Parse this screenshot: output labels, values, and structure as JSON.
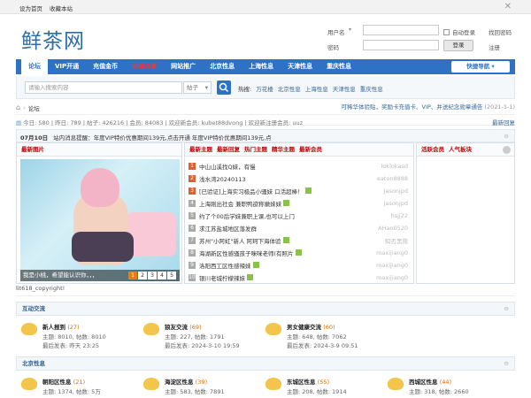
{
  "topbar": {
    "set_home": "设为首页",
    "bookmark": "收藏本站"
  },
  "header": {
    "logo": "鲜茶网",
    "username_label": "用户名",
    "password_label": "密码",
    "auto_login": "自动登录",
    "find_password": "找回密码",
    "login_btn": "登录",
    "register": "注册"
  },
  "nav": {
    "items": [
      "论坛",
      "VIP开通",
      "充值金币",
      "同城必看",
      "网站推广",
      "北京性息",
      "上海性息",
      "天津性息",
      "重庆性息"
    ],
    "quick": "快捷导航"
  },
  "search": {
    "placeholder": "请输入搜索内容",
    "type": "帖子",
    "hot_label": "热搜:",
    "hot": [
      "万花楼",
      "北京性息",
      "上海性息",
      "天津性息",
      "重庆性息"
    ]
  },
  "crumb": {
    "current": "论坛",
    "notice": "可稀华体验贴，奖励卡充值卡、VIP、并送纪念勋章通告",
    "notice_date": "(2021-1-1)"
  },
  "stats": {
    "text": "今日: 580 | 昨日: 789 | 帖子: 426216 | 会员: 84083 | 欢迎新会员: kubet88dvong | 欢迎新注册会员: uuz",
    "latest": "最新回复"
  },
  "announce": {
    "date": "07月10日",
    "text": "站内消息提醒：年度VIP特价优惠期间139元,点击开通   年度VIP特价优惠期间139元,点"
  },
  "pic_panel": {
    "tab": "最新图片",
    "caption": "我是小桃，希望能认识你，，，",
    "pages": [
      "1",
      "2",
      "3",
      "4",
      "5"
    ]
  },
  "list_panel": {
    "tabs": [
      "最新主题",
      "最新回复",
      "热门主题",
      "精华主题",
      "最新会员"
    ],
    "rows": [
      {
        "n": "1",
        "title": "中山山溪找Q妹，有慢",
        "author": "loklokasd"
      },
      {
        "n": "2",
        "title": "浅水湾20240113",
        "author": "eaton8888"
      },
      {
        "n": "3",
        "title": "[已验证]上海实习极品小骚妹 口活超棒！",
        "author": "jasonjpd"
      },
      {
        "n": "4",
        "title": "上海刚出社会 兼职鸭欲称嫩妹妹",
        "author": "jasonjpd"
      },
      {
        "n": "5",
        "title": "约了个00后学妹兼职上课,也可以上门",
        "author": "hsjj22"
      },
      {
        "n": "6",
        "title": "求江苏盐城地区落发群",
        "author": "AHao0520"
      },
      {
        "n": "7",
        "title": "苏州\"小阿虹\"新人 阿珂下海体验",
        "author": "知否黑熊"
      },
      {
        "n": "8",
        "title": "海湖新区性感骚孩子咪咪老师(有照片",
        "author": "maxijiang0"
      },
      {
        "n": "9",
        "title": "洛阳西工区性感辣妹",
        "author": "maxijiang0"
      },
      {
        "n": "10",
        "title": "银川老城柠檬辣妹",
        "author": "maxijiang0"
      }
    ]
  },
  "active_panel": {
    "tabs": [
      "活跃会员",
      "人气板块"
    ]
  },
  "copyright": "lit618_copyright!",
  "sections": [
    {
      "title": "互动交流",
      "forums": [
        {
          "name": "新人报到",
          "count": "(27)",
          "l1": "主题: 8010, 帖数: 8010",
          "l2": "最后发表: 昨天 23:25"
        },
        {
          "name": "狼友交流",
          "count": "(69)",
          "l1": "主题: 227, 帖数: 1791",
          "l2": "最后发表: 2024-3-10 19:59"
        },
        {
          "name": "男女健康交流",
          "count": "(60)",
          "l1": "主题: 648, 帖数: 7062",
          "l2": "最后发表: 2024-3-9 09:51"
        }
      ]
    },
    {
      "title": "北京性息",
      "forums": [
        {
          "name": "朝阳区性息",
          "count": "(21)",
          "l1": "主题: 1374, 帖数: 5万"
        },
        {
          "name": "海淀区性息",
          "count": "(39)",
          "l1": "主题: 583, 帖数: 7891"
        },
        {
          "name": "东城区性息",
          "count": "(55)",
          "l1": "主题: 208, 帖数: 1914"
        },
        {
          "name": "西城区性息",
          "count": "(44)",
          "l1": "主题: 318, 帖数: 2660"
        }
      ]
    }
  ]
}
